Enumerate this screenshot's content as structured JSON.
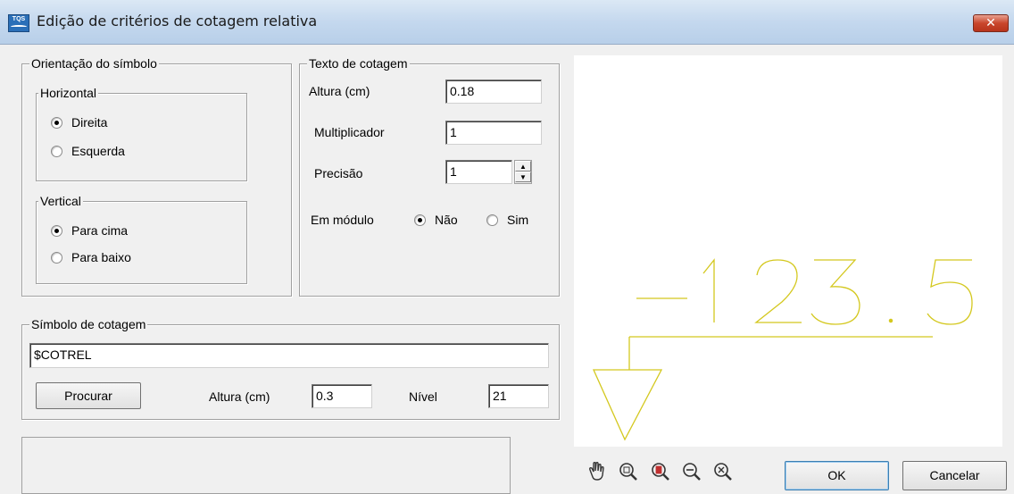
{
  "window": {
    "title": "Edição de critérios de cotagem relativa",
    "app_icon_text": "TQS",
    "close_label": "✕"
  },
  "orientacao": {
    "legend": "Orientação do símbolo",
    "horizontal": {
      "legend": "Horizontal",
      "options": [
        {
          "label": "Direita",
          "checked": true
        },
        {
          "label": "Esquerda",
          "checked": false
        }
      ]
    },
    "vertical": {
      "legend": "Vertical",
      "options": [
        {
          "label": "Para cima",
          "checked": true
        },
        {
          "label": "Para baixo",
          "checked": false
        }
      ]
    }
  },
  "texto": {
    "legend": "Texto de cotagem",
    "altura_label": "Altura (cm)",
    "altura_value": "0.18",
    "multiplicador_label": "Multiplicador",
    "multiplicador_value": "1",
    "precisao_label": "Precisão",
    "precisao_value": "1",
    "em_modulo_label": "Em módulo",
    "em_modulo_options": [
      {
        "label": "Não",
        "checked": true
      },
      {
        "label": "Sim",
        "checked": false
      }
    ]
  },
  "simbolo": {
    "legend": "Símbolo de cotagem",
    "value": "$COTREL",
    "procurar_label": "Procurar",
    "altura_label": "Altura (cm)",
    "altura_value": "0.3",
    "nivel_label": "Nível",
    "nivel_value": "21"
  },
  "preview": {
    "text": "-123.5",
    "color": "#d4c81e"
  },
  "toolbar": {
    "icons": [
      "pan-icon",
      "zoom-window-icon",
      "zoom-all-icon",
      "zoom-out-icon",
      "zoom-previous-icon"
    ]
  },
  "buttons": {
    "ok_label": "OK",
    "cancel_label": "Cancelar"
  }
}
